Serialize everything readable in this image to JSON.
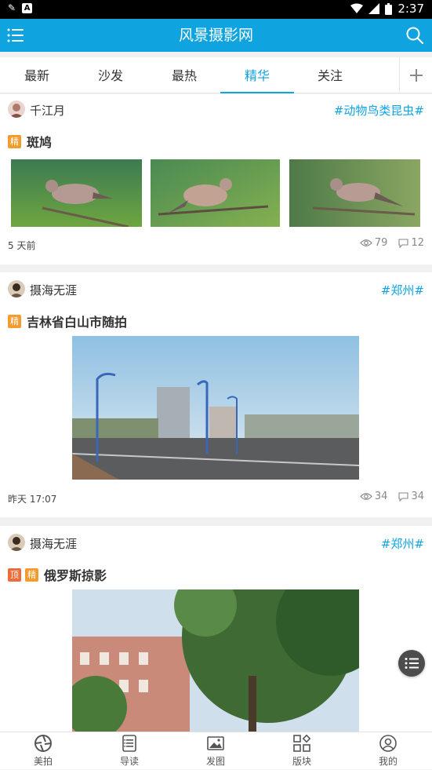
{
  "status": {
    "time": "2:37"
  },
  "appbar": {
    "title": "风景摄影网"
  },
  "tabs": [
    {
      "label": "最新"
    },
    {
      "label": "沙发"
    },
    {
      "label": "最热"
    },
    {
      "label": "精华",
      "active": true
    },
    {
      "label": "关注"
    }
  ],
  "posts": [
    {
      "author": "千江月",
      "tag": "#动物鸟类昆虫#",
      "badges": [
        "精"
      ],
      "title": "斑鸠",
      "time": "5 天前",
      "views": "79",
      "comments": "12"
    },
    {
      "author": "摄海无涯",
      "tag": "#郑州#",
      "badges": [
        "精"
      ],
      "title": "吉林省白山市随拍",
      "time": "昨天 17:07",
      "views": "34",
      "comments": "34"
    },
    {
      "author": "摄海无涯",
      "tag": "#郑州#",
      "badges": [
        "顶",
        "精"
      ],
      "title": "俄罗斯掠影"
    }
  ],
  "bottomnav": [
    {
      "label": "美拍",
      "icon": "aperture-icon"
    },
    {
      "label": "导读",
      "icon": "list-icon"
    },
    {
      "label": "发图",
      "icon": "image-icon"
    },
    {
      "label": "版块",
      "icon": "blocks-icon"
    },
    {
      "label": "我的",
      "icon": "profile-icon"
    }
  ],
  "colors": {
    "accent": "#0fa3e0",
    "badge_jing": "#f39b2b",
    "badge_ding": "#ee6b3a"
  }
}
